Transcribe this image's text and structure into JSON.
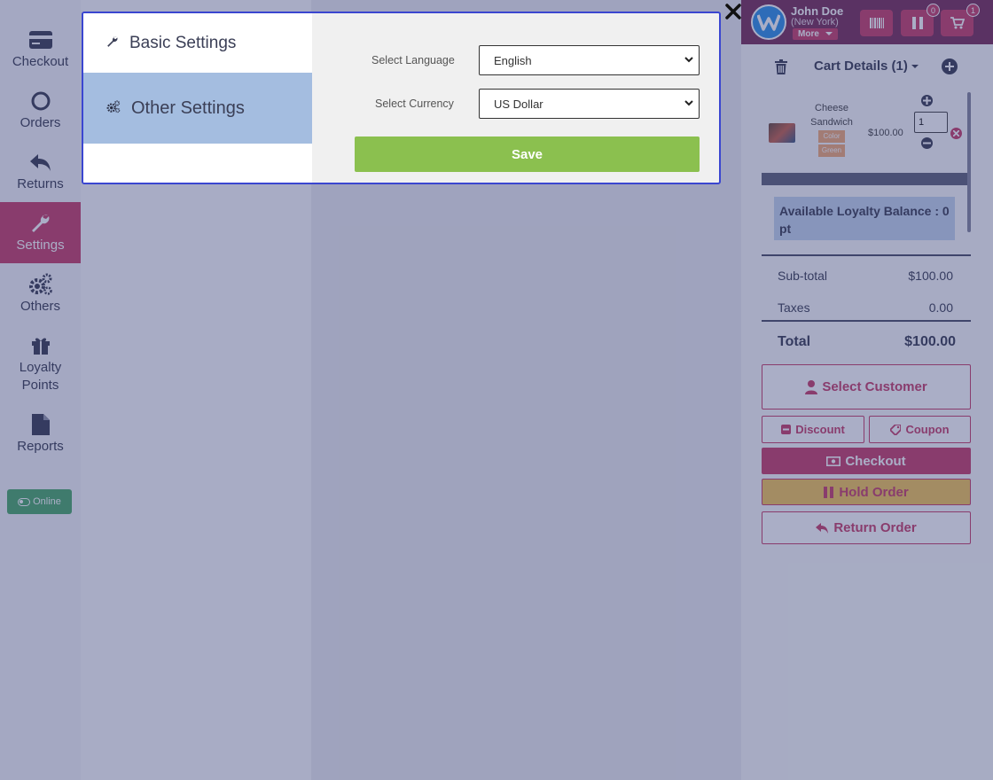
{
  "sidebar": {
    "items": [
      {
        "label": "Checkout",
        "icon": "credit-card-icon"
      },
      {
        "label": "Orders",
        "icon": "circle-icon"
      },
      {
        "label": "Returns",
        "icon": "reply-icon"
      },
      {
        "label": "Settings",
        "icon": "wrench-icon"
      },
      {
        "label": "Others",
        "icon": "cogs-icon"
      },
      {
        "label": "Loyalty Points",
        "icon": "gift-icon"
      },
      {
        "label": "Reports",
        "icon": "file-icon"
      }
    ],
    "active": "Settings",
    "online_label": "Online"
  },
  "header": {
    "user_name": "John Doe",
    "user_location": "(New York)",
    "more_label": "More",
    "hold_badge": "0",
    "cart_badge": "1"
  },
  "cart": {
    "title": "Cart Details (1)",
    "item": {
      "name_line1": "Cheese",
      "name_line2": "Sandwich",
      "tag1": "Color",
      "tag2": "Green",
      "price": "$100.00",
      "quantity": "1"
    },
    "loyalty_text": "Available Loyalty Balance : 0 pt",
    "subtotal_label": "Sub-total",
    "subtotal_value": "$100.00",
    "taxes_label": "Taxes",
    "taxes_value": "0.00",
    "total_label": "Total",
    "total_value": "$100.00"
  },
  "actions": {
    "select_customer": "Select Customer",
    "discount": "Discount",
    "coupon": "Coupon",
    "checkout": "Checkout",
    "hold_order": "Hold Order",
    "return_order": "Return Order"
  },
  "modal": {
    "menu": [
      {
        "label": "Basic Settings",
        "icon": "wrench-icon"
      },
      {
        "label": "Other Settings",
        "icon": "cogs-icon"
      }
    ],
    "selected_menu": "Other Settings",
    "language_label": "Select Language",
    "language_value": "English",
    "currency_label": "Select Currency",
    "currency_value": "US Dollar",
    "save_label": "Save"
  },
  "colors": {
    "accent": "#c3315e",
    "topbar": "#6e1e4b",
    "save": "#8bc04f",
    "hold": "#f2c14b",
    "online": "#3da35d",
    "selected_menu": "#a4bde0"
  }
}
